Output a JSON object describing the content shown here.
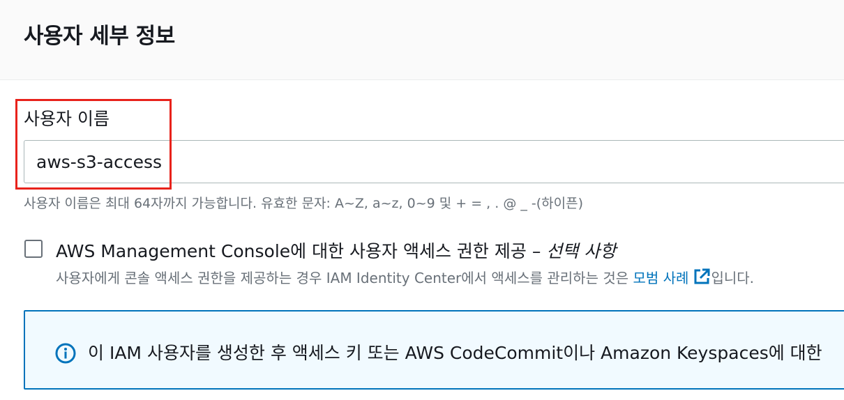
{
  "header": {
    "title": "사용자 세부 정보"
  },
  "username": {
    "label": "사용자 이름",
    "value": "aws-s3-access",
    "hint": "사용자 이름은 최대 64자까지 가능합니다. 유효한 문자: A~Z, a~z, 0~9 및 + = , . @ _ -(하이픈)"
  },
  "console_access": {
    "checked": false,
    "label": "AWS Management Console에 대한 사용자 액세스 권한 제공 – ",
    "optional": "선택 사항",
    "description": "사용자에게 콘솔 액세스 권한을 제공하는 경우 IAM Identity Center에서 액세스를 관리하는 것은 ",
    "link_text": "모범 사례",
    "description_suffix": "입니다."
  },
  "info": {
    "text": "이 IAM 사용자를 생성한 후 액세스 키 또는 AWS CodeCommit이나 Amazon Keyspaces에 대한"
  },
  "colors": {
    "highlight": "#e8221b",
    "link": "#0073bb",
    "info_border": "#0073bb",
    "info_background": "#f1faff"
  }
}
